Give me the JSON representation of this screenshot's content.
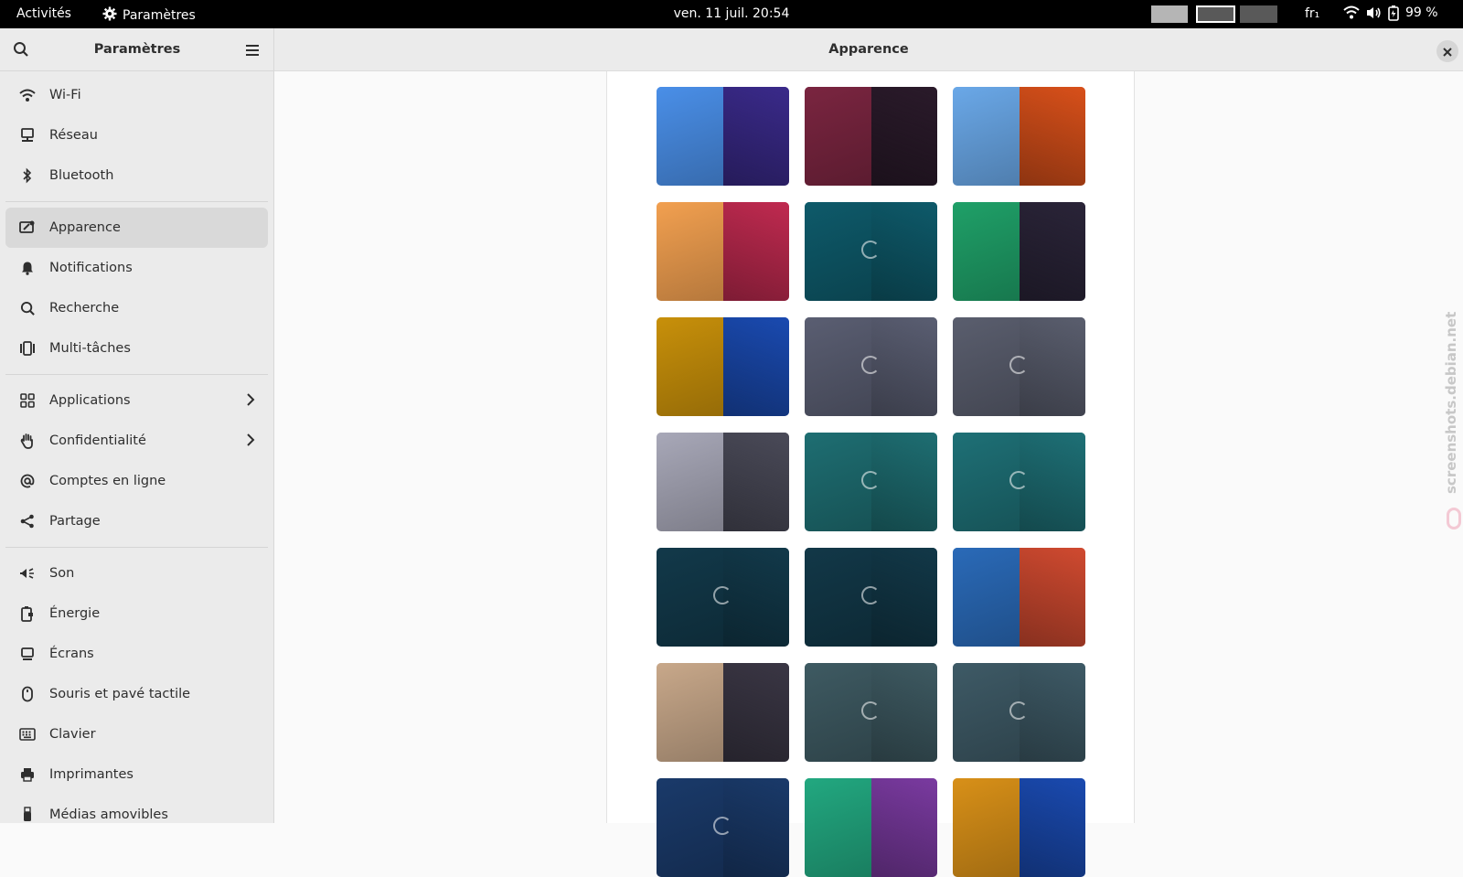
{
  "topbar": {
    "activities": "Activités",
    "app_name": "Paramètres",
    "clock": "ven. 11 juil.  20:54",
    "language": "fr₁",
    "battery": "99 %"
  },
  "sidebar": {
    "title": "Paramètres",
    "items": [
      {
        "label": "Wi-Fi",
        "icon": "wifi-icon"
      },
      {
        "label": "Réseau",
        "icon": "network-icon"
      },
      {
        "label": "Bluetooth",
        "icon": "bluetooth-icon"
      },
      {
        "label": "Apparence",
        "icon": "appearance-icon"
      },
      {
        "label": "Notifications",
        "icon": "bell-icon"
      },
      {
        "label": "Recherche",
        "icon": "search-icon"
      },
      {
        "label": "Multi-tâches",
        "icon": "multitask-icon"
      },
      {
        "label": "Applications",
        "icon": "apps-grid-icon"
      },
      {
        "label": "Confidentialité",
        "icon": "hand-icon"
      },
      {
        "label": "Comptes en ligne",
        "icon": "at-icon"
      },
      {
        "label": "Partage",
        "icon": "share-icon"
      },
      {
        "label": "Son",
        "icon": "speaker-icon"
      },
      {
        "label": "Énergie",
        "icon": "battery-icon"
      },
      {
        "label": "Écrans",
        "icon": "display-icon"
      },
      {
        "label": "Souris et pavé tactile",
        "icon": "mouse-icon"
      },
      {
        "label": "Clavier",
        "icon": "keyboard-icon"
      },
      {
        "label": "Imprimantes",
        "icon": "printer-icon"
      },
      {
        "label": "Médias amovibles",
        "icon": "usb-icon"
      }
    ]
  },
  "main": {
    "title": "Apparence",
    "wallpapers": [
      {
        "left": "#4a8fe8",
        "right": "#3a2a8a"
      },
      {
        "left": "#7a2540",
        "right": "#2a1a2a"
      },
      {
        "left": "#6aa8e8",
        "right": "#d8501a"
      },
      {
        "left": "#f2a050",
        "right": "#c02a50"
      },
      {
        "left": "#0e5a6a",
        "right": "#0e5a6a"
      },
      {
        "left": "#1fa068",
        "right": "#2a2438"
      },
      {
        "left": "#c8900a",
        "right": "#1a4ab0"
      },
      {
        "left": "#5a5e72",
        "right": "#5a5e72"
      },
      {
        "left": "#5a5e6e",
        "right": "#5a5e6e"
      },
      {
        "left": "#a8a8b8",
        "right": "#4a4a58"
      },
      {
        "left": "#1e6e72",
        "right": "#1e6e72"
      },
      {
        "left": "#1e7076",
        "right": "#1e7076"
      },
      {
        "left": "#12394a",
        "right": "#12394a"
      },
      {
        "left": "#123848",
        "right": "#123848"
      },
      {
        "left": "#2a6ab8",
        "right": "#d04a30"
      },
      {
        "left": "#c8a88a",
        "right": "#3a3644"
      },
      {
        "left": "#3e5a62",
        "right": "#3e5a62"
      },
      {
        "left": "#3e5a66",
        "right": "#3e5a66"
      },
      {
        "left": "#1a3a6a",
        "right": "#1a3a6a"
      },
      {
        "left": "#22a880",
        "right": "#7a3aa0"
      },
      {
        "left": "#d89018",
        "right": "#1a4ab0"
      }
    ]
  },
  "watermark": "screenshots.debian.net"
}
